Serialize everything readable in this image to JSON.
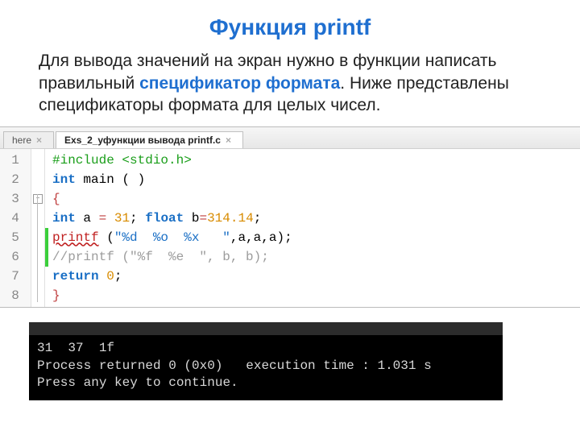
{
  "title": "Функция printf",
  "desc_before": "    Для вывода значений на экран нужно в функции написать правильный ",
  "desc_hl": "спецификатор формата",
  "desc_after": ". Ниже представлены спецификаторы формата для целых чисел.",
  "tabs": {
    "inactive": "here",
    "active": "Exs_2_уфункции вывода printf.c"
  },
  "gutter": [
    "1",
    "2",
    "3",
    "4",
    "5",
    "6",
    "7",
    "8"
  ],
  "code": {
    "l1_pre": "#include <stdio.h>",
    "l2_kw1": "int",
    "l2_rest": " main ( )",
    "l3": "{",
    "l4_kw1": "int",
    "l4_a": " a ",
    "l4_eq": "=",
    "l4_n1": " 31",
    "l4_sc": "; ",
    "l4_kw2": "float",
    "l4_b": " b",
    "l4_eq2": "=",
    "l4_n2": "314.14",
    "l4_end": ";",
    "l5_err": "printf",
    "l5_mid": " (",
    "l5_str": "\"%d  %o  %x   \"",
    "l5_after": ",a,a,a)",
    "l5_sc": ";",
    "l6_cmt": "//printf (\"%f  %e  \", b, b);",
    "l7_kw": "return",
    "l7_rest": " ",
    "l7_n": "0",
    "l7_sc": ";",
    "l8": "}"
  },
  "console": {
    "l1": "31  37  1f",
    "l2": "Process returned 0 (0x0)   execution time : 1.031 s",
    "l3": "Press any key to continue."
  }
}
